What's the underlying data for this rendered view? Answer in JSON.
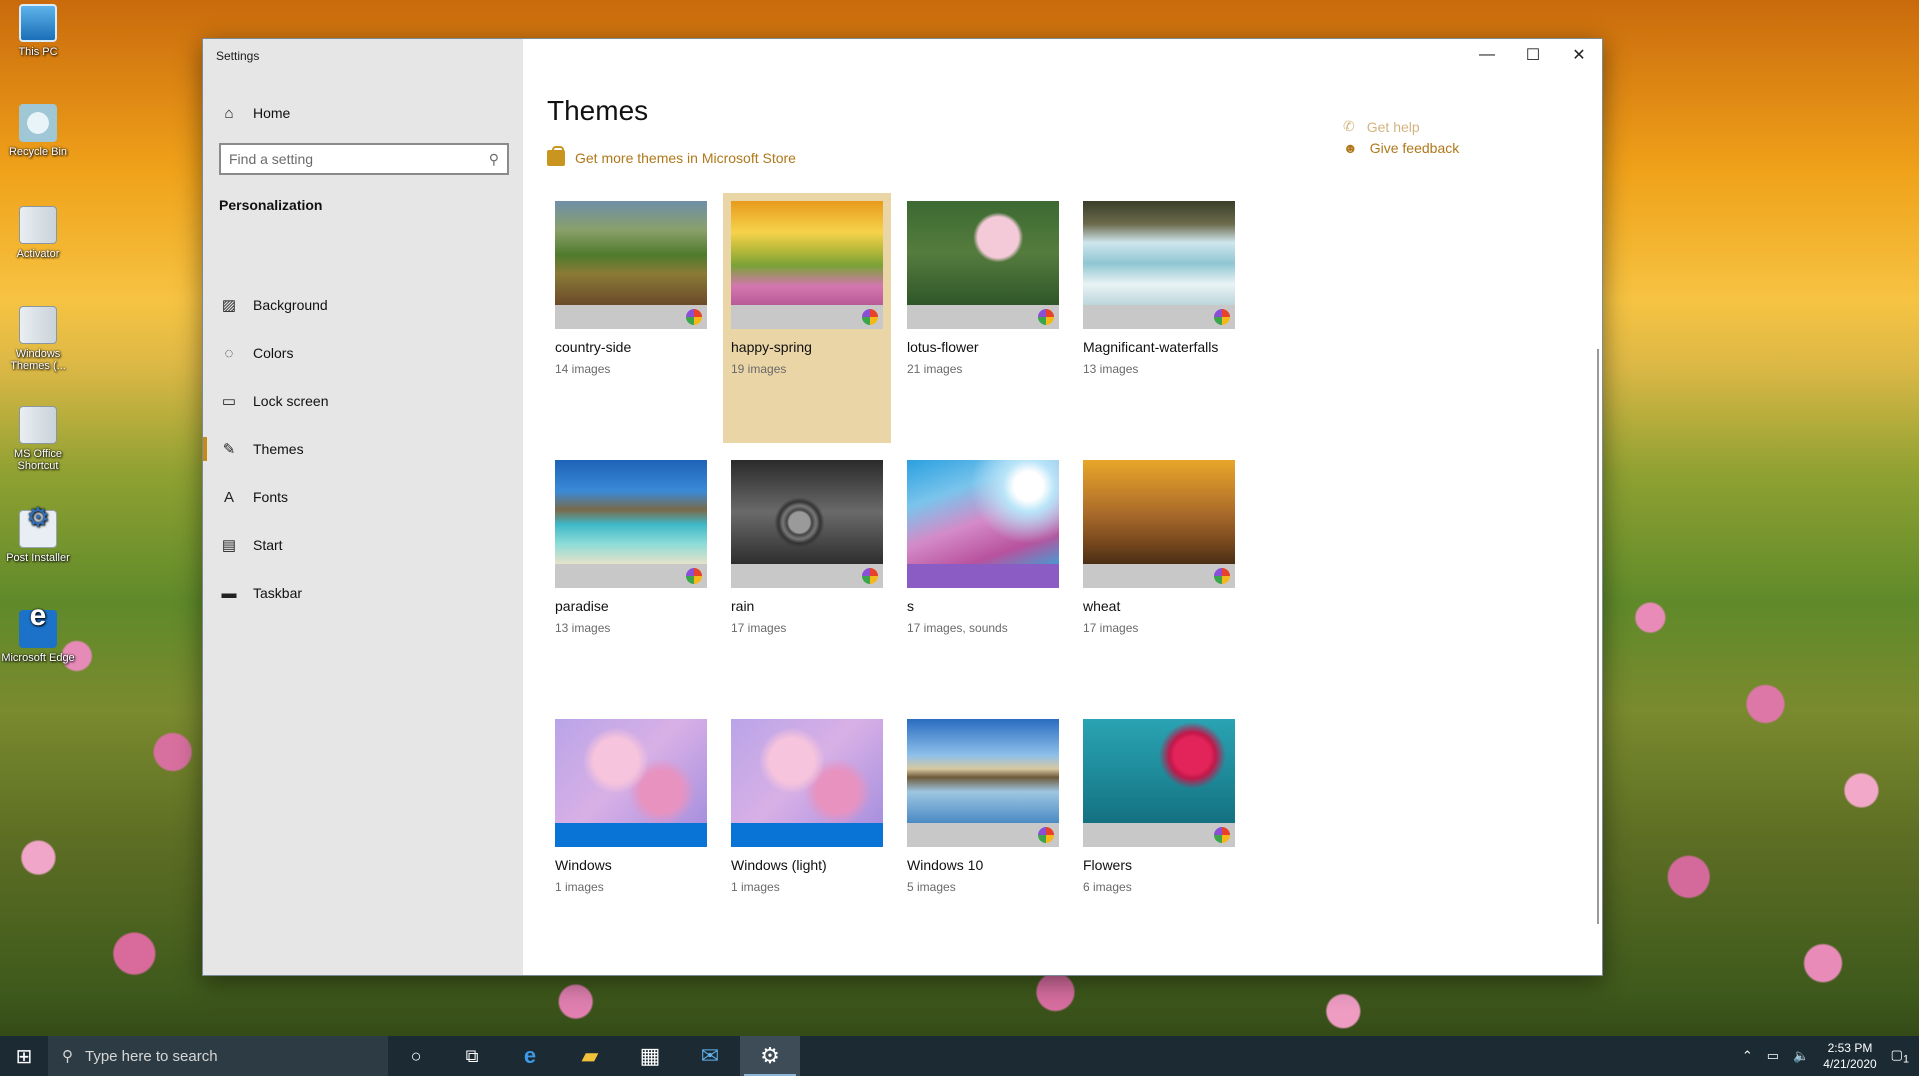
{
  "desktop": {
    "icons": [
      {
        "label": "This PC",
        "icon": "computer-icon"
      },
      {
        "label": "Recycle Bin",
        "icon": "recycle-bin-icon"
      },
      {
        "label": "Activator",
        "icon": "file-icon"
      },
      {
        "label": "Windows Themes (...",
        "icon": "file-icon"
      },
      {
        "label": "MS Office Shortcut",
        "icon": "file-icon"
      },
      {
        "label": "Post Installer",
        "icon": "gear-icon"
      },
      {
        "label": "Microsoft Edge",
        "icon": "edge-icon"
      }
    ]
  },
  "window": {
    "title": "Settings",
    "caption": {
      "minimize": "—",
      "maximize": "☐",
      "close": "✕"
    }
  },
  "sidebar": {
    "home_label": "Home",
    "search_placeholder": "Find a setting",
    "section_title": "Personalization",
    "items": [
      {
        "label": "Background",
        "icon": "background-icon",
        "active": false
      },
      {
        "label": "Colors",
        "icon": "palette-icon",
        "active": false
      },
      {
        "label": "Lock screen",
        "icon": "lock-screen-icon",
        "active": false
      },
      {
        "label": "Themes",
        "icon": "themes-icon",
        "active": true
      },
      {
        "label": "Fonts",
        "icon": "fonts-icon",
        "active": false
      },
      {
        "label": "Start",
        "icon": "start-icon",
        "active": false
      },
      {
        "label": "Taskbar",
        "icon": "taskbar-icon",
        "active": false
      }
    ]
  },
  "main": {
    "title": "Themes",
    "store_link": "Get more themes in Microsoft Store",
    "help_link": "Get help",
    "feedback_link": "Give feedback",
    "themes": [
      {
        "name": "country-side",
        "count": "14 images",
        "selected": false,
        "bar_color": "#c8c8c8",
        "color_icon": true,
        "gradient": "linear-gradient(180deg,#6d8fa8 0%,#8aa06a 28%,#4f7a2c 52%,#8a7a36 70%,#6a4a2a 100%)"
      },
      {
        "name": "happy-spring",
        "count": "19 images",
        "selected": true,
        "bar_color": "#c8c8c8",
        "color_icon": true,
        "gradient": "linear-gradient(180deg,#e89a1c 0%,#f7d34a 30%,#b4b83a 48%,#7aa236 62%,#d476b0 82%,#b85a95 100%)"
      },
      {
        "name": "lotus-flower",
        "count": "21 images",
        "selected": false,
        "bar_color": "#c8c8c8",
        "color_icon": true,
        "gradient": "radial-gradient(circle at 60% 35%,#f4c9d8 0 18%,transparent 22%),linear-gradient(180deg,#3c6a32 0%,#557c3e 50%,#2f5628 100%)"
      },
      {
        "name": "Magnificant-waterfalls",
        "count": "13 images",
        "selected": false,
        "bar_color": "#c8c8c8",
        "color_icon": true,
        "gradient": "linear-gradient(180deg,#3a3f2a 0%,#6b6a4a 22%,#cfe6ee 40%,#8fc6d2 60%,#e9f3f4 80%,#bcd6dc 100%)"
      },
      {
        "name": "paradise",
        "count": "13 images",
        "selected": false,
        "bar_color": "#c8c8c8",
        "color_icon": true,
        "gradient": "linear-gradient(180deg,#1e62b8 0%,#3a8ad6 30%,#7a6a4a 48%,#3fb8c8 62%,#8adbd8 80%,#e6e2c8 100%)"
      },
      {
        "name": "rain",
        "count": "17 images",
        "selected": false,
        "bar_color": "#c8c8c8",
        "color_icon": true,
        "gradient": "radial-gradient(circle at 45% 60%,#9a9a9a 0 10%,#444 12%,#777 16%,#333 20%,transparent 24%),linear-gradient(180deg,#2a2a2a,#6a6a6a 50%,#2e2e2e)"
      },
      {
        "name": "s",
        "count": "17 images, sounds",
        "selected": false,
        "bar_color": "#8a5cc4",
        "color_icon": false,
        "gradient": "radial-gradient(circle at 80% 25%,#ffffff 0 10%,#b8e4f8 18%,transparent 40%),linear-gradient(160deg,#2aa0e0 0%,#7ac4ec 30%,#d48ac8 55%,#b8529e 80%,#4a9ad0 100%)"
      },
      {
        "name": "wheat",
        "count": "17 images",
        "selected": false,
        "bar_color": "#c8c8c8",
        "color_icon": true,
        "gradient": "linear-gradient(180deg,#e8a62a 0%,#c8862a 28%,#a86a2a 52%,#7a4a1e 78%,#4a2e14 100%)"
      },
      {
        "name": "Windows",
        "count": "1 images",
        "selected": false,
        "bar_color": "#0a74d6",
        "color_icon": false,
        "gradient": "radial-gradient(circle at 40% 40%,#f6c4dc 0 20%,transparent 30%),radial-gradient(circle at 70% 70%,#e892c0 0 16%,transparent 26%),linear-gradient(135deg,#b9a4e8,#d8b0e6 50%,#a890de)"
      },
      {
        "name": "Windows (light)",
        "count": "1 images",
        "selected": false,
        "bar_color": "#0a74d6",
        "color_icon": false,
        "gradient": "radial-gradient(circle at 40% 40%,#f6c4dc 0 20%,transparent 30%),radial-gradient(circle at 70% 70%,#e892c0 0 16%,transparent 26%),linear-gradient(135deg,#b9a4e8,#d8b0e6 50%,#a890de)"
      },
      {
        "name": "Windows 10",
        "count": "5 images",
        "selected": false,
        "bar_color": "#c8c8c8",
        "color_icon": true,
        "gradient": "linear-gradient(180deg,#2a6cc0 0%,#8ec0ea 35%,#d8c8a0 48%,#6e5a3a 56%,#9ec6e2 70%,#4a8ac4 100%)"
      },
      {
        "name": "Flowers",
        "count": "6 images",
        "selected": false,
        "bar_color": "#c8c8c8",
        "color_icon": true,
        "gradient": "radial-gradient(circle at 72% 35%,#e2245a 0 14%,#c0184a 18%,transparent 26%),linear-gradient(180deg,#2aa3b2,#1f8c9c 50%,#147080)"
      }
    ]
  },
  "taskbar": {
    "search_placeholder": "Type here to search",
    "time": "2:53 PM",
    "date": "4/21/2020",
    "notification_count": "1"
  }
}
